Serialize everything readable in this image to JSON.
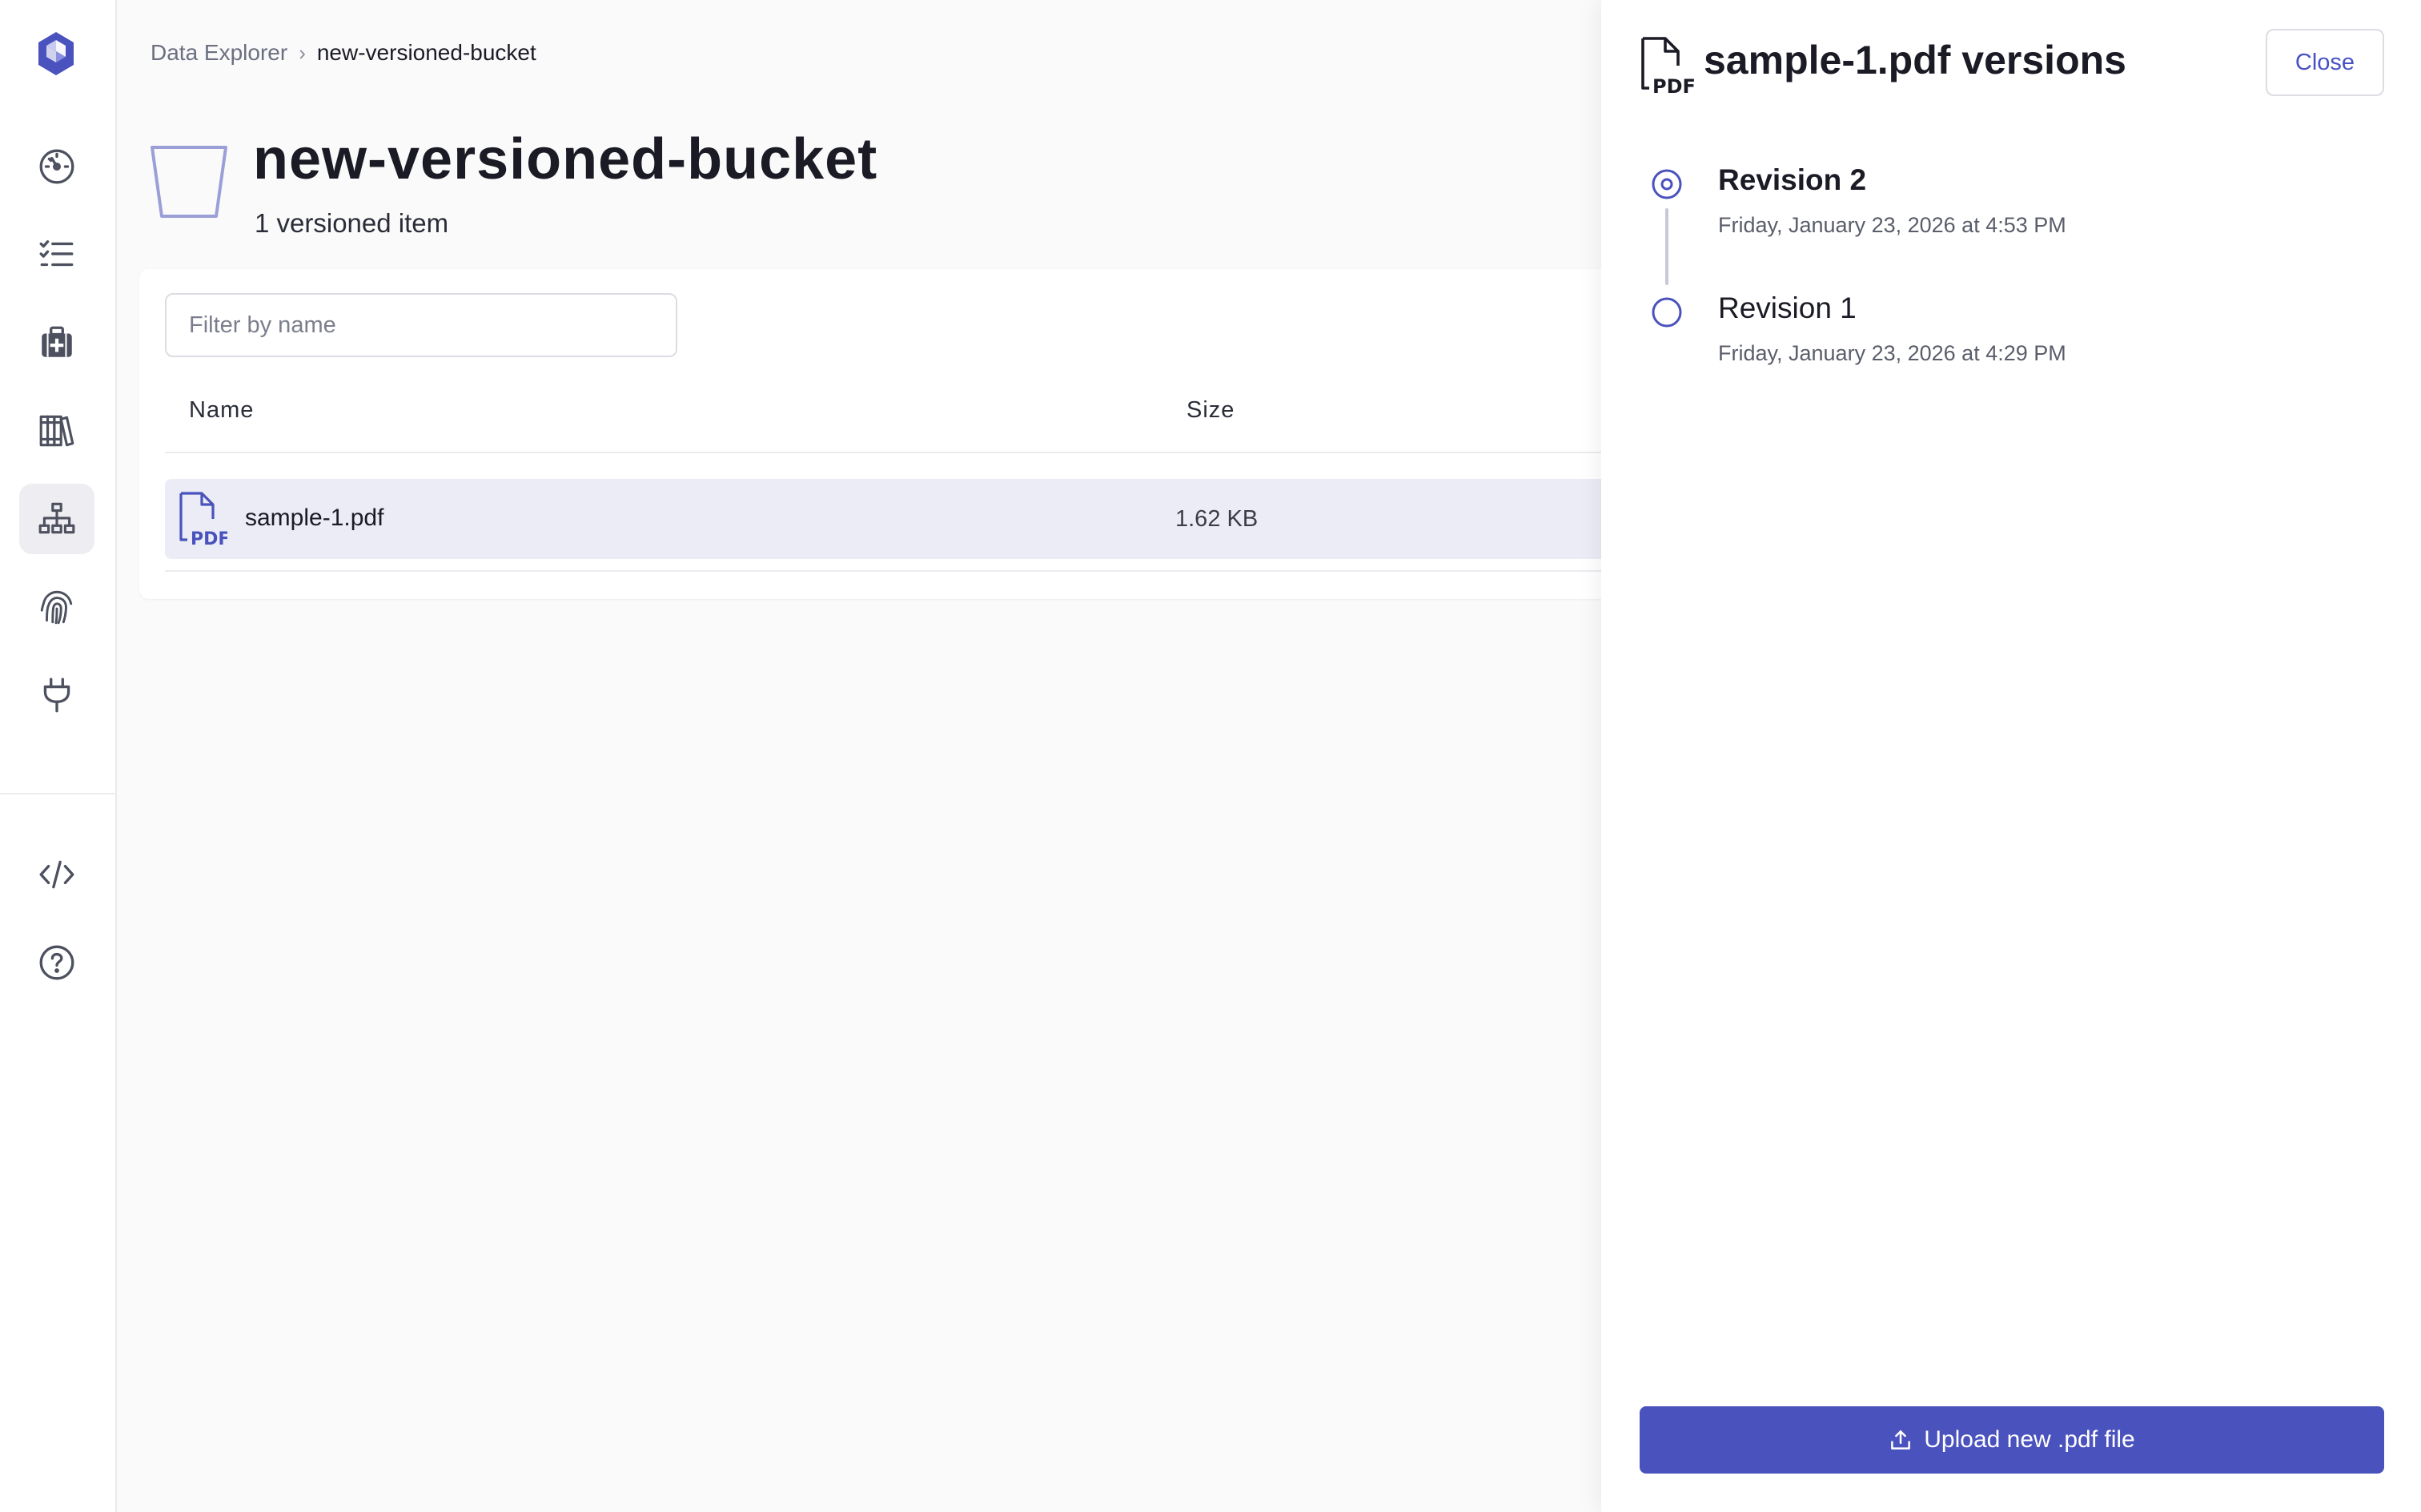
{
  "app": {
    "brand_color": "#4a52bd",
    "accent_text_color": "#4752c4"
  },
  "sidebar": {
    "items": [
      {
        "icon": "dashboard-gauge-icon"
      },
      {
        "icon": "checklist-icon"
      },
      {
        "icon": "first-aid-kit-icon"
      },
      {
        "icon": "library-books-icon"
      },
      {
        "icon": "hierarchy-network-icon",
        "active": true
      },
      {
        "icon": "fingerprint-icon"
      },
      {
        "icon": "plug-icon"
      },
      {
        "icon": "code-icon"
      },
      {
        "icon": "help-circle-icon"
      }
    ]
  },
  "breadcrumb": {
    "parent": "Data Explorer",
    "separator": "›",
    "current": "new-versioned-bucket"
  },
  "header": {
    "title": "new-versioned-bucket",
    "subtitle": "1 versioned item"
  },
  "table": {
    "filter_placeholder": "Filter by name",
    "columns": [
      "Name",
      "Size"
    ],
    "rows": [
      {
        "name": "sample-1.pdf",
        "size": "1.62 KB",
        "icon": "pdf-file-icon",
        "selected": true
      }
    ]
  },
  "drawer": {
    "title": "sample-1.pdf versions",
    "close_label": "Close",
    "revisions": [
      {
        "label": "Revision 2",
        "date": "Friday, January 23, 2026 at 4:53 PM",
        "current": true
      },
      {
        "label": "Revision 1",
        "date": "Friday, January 23, 2026 at 4:29 PM",
        "current": false
      }
    ],
    "upload_label": "Upload new .pdf file"
  }
}
